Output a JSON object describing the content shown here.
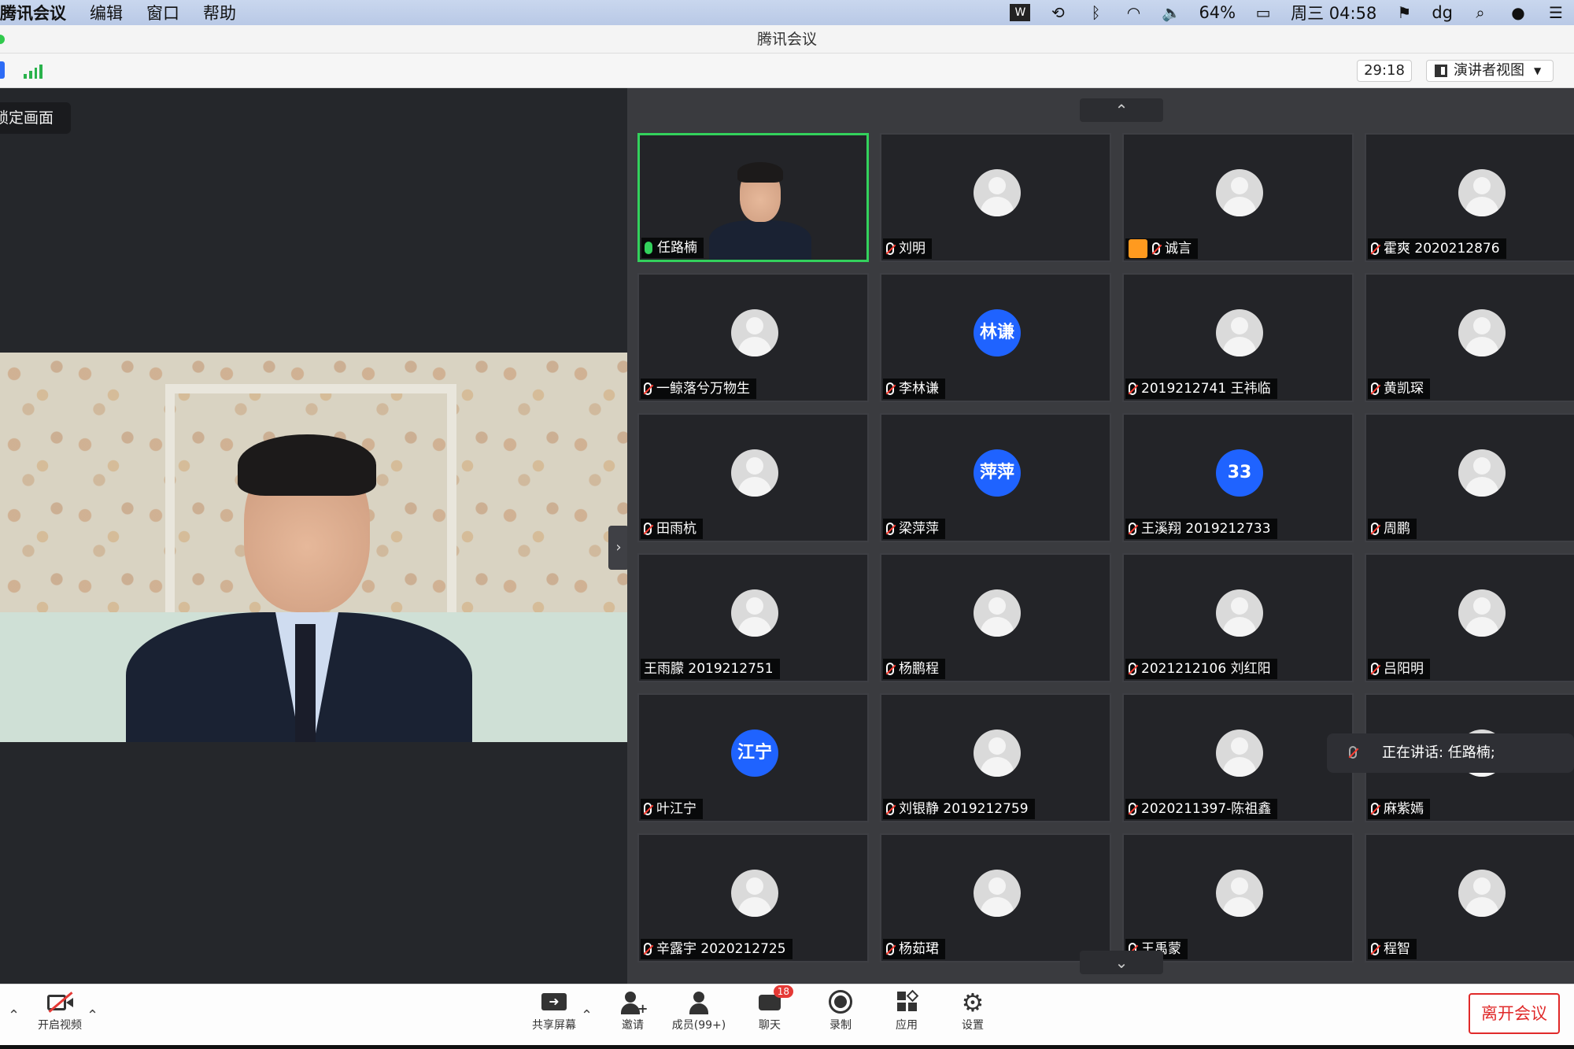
{
  "menubar": {
    "app": "腾讯会议",
    "items": [
      "编辑",
      "窗口",
      "帮助"
    ],
    "battery": "64%",
    "clock": "周三 04:58",
    "user": "dg"
  },
  "window": {
    "title": "腾讯会议"
  },
  "toolbar": {
    "timer": "29:18",
    "view_label": "演讲者视图"
  },
  "main": {
    "lock_label": "锁定画面"
  },
  "grid": {
    "tiles": [
      {
        "name": "任路楠",
        "type": "video",
        "active": true,
        "mic": "on"
      },
      {
        "name": "刘明",
        "type": "avatar",
        "mic": "muted"
      },
      {
        "name": "诚言",
        "type": "avatar",
        "mic": "muted",
        "extra_icon": true
      },
      {
        "name": "霍爽 2020212876",
        "type": "avatar",
        "mic": "muted"
      },
      {
        "name": "一鲸落兮万物生",
        "type": "avatar",
        "mic": "muted"
      },
      {
        "name": "李林谦",
        "type": "badge",
        "badge": "林谦",
        "mic": "muted"
      },
      {
        "name": "2019212741 王祎临",
        "type": "avatar",
        "mic": "muted"
      },
      {
        "name": "黄凯琛",
        "type": "avatar",
        "mic": "muted"
      },
      {
        "name": "田雨杭",
        "type": "avatar",
        "mic": "muted"
      },
      {
        "name": "梁萍萍",
        "type": "badge",
        "badge": "萍萍",
        "mic": "muted"
      },
      {
        "name": "王溪翔 2019212733",
        "type": "badge",
        "badge": "33",
        "mic": "muted"
      },
      {
        "name": "周鹏",
        "type": "avatar",
        "mic": "muted"
      },
      {
        "name": "王雨朦 2019212751",
        "type": "avatar",
        "mic": "none"
      },
      {
        "name": "杨鹏程",
        "type": "avatar",
        "mic": "muted"
      },
      {
        "name": "2021212106 刘红阳",
        "type": "avatar",
        "mic": "muted"
      },
      {
        "name": "吕阳明",
        "type": "avatar",
        "mic": "muted"
      },
      {
        "name": "叶江宁",
        "type": "badge",
        "badge": "江宁",
        "mic": "muted"
      },
      {
        "name": "刘银静 2019212759",
        "type": "avatar",
        "mic": "muted"
      },
      {
        "name": "2020211397-陈祖鑫",
        "type": "avatar",
        "mic": "muted"
      },
      {
        "name": "麻紫嫣",
        "type": "avatar",
        "mic": "muted"
      },
      {
        "name": "辛露宇 2020212725",
        "type": "avatar",
        "mic": "muted"
      },
      {
        "name": "杨茹珺",
        "type": "avatar",
        "mic": "muted"
      },
      {
        "name": "王禹蒙",
        "type": "avatar",
        "mic": "muted"
      },
      {
        "name": "程智",
        "type": "avatar",
        "mic": "muted"
      }
    ]
  },
  "speaking": {
    "label": "正在讲话: 任路楠;"
  },
  "bottom": {
    "video": "开启视频",
    "share": "共享屏幕",
    "invite": "邀请",
    "members": "成员(99+)",
    "chat": "聊天",
    "chat_badge": "18",
    "record": "录制",
    "apps": "应用",
    "settings": "设置",
    "leave": "离开会议"
  },
  "colors": {
    "accent": "#1f63ff",
    "active_border": "#33d15c",
    "leave": "#e02a2a"
  }
}
